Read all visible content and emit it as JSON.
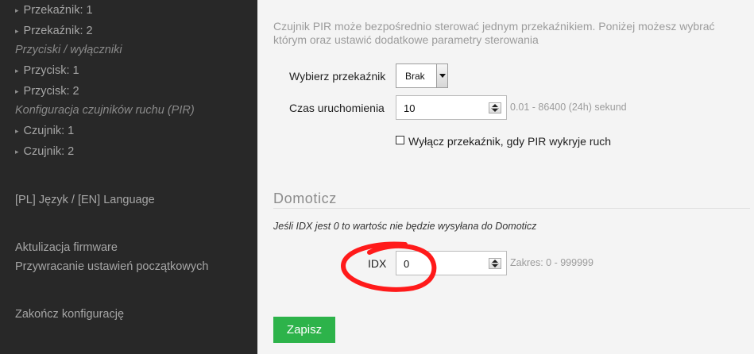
{
  "sidebar": {
    "items": [
      {
        "label": "Przekaźnik: 1",
        "arrow": true
      },
      {
        "label": "Przekaźnik: 2",
        "arrow": true
      },
      {
        "label": "Przyciski / wyłączniki",
        "heading": true
      },
      {
        "label": "Przycisk: 1",
        "arrow": true
      },
      {
        "label": "Przycisk: 2",
        "arrow": true
      },
      {
        "label": "Konfiguracja czujników ruchu (PIR)",
        "heading": true
      },
      {
        "label": "Czujnik: 1",
        "arrow": true
      },
      {
        "label": "Czujnik: 2",
        "arrow": true
      },
      {
        "label": "[PL] Język / [EN] Language"
      },
      {
        "label": "Aktulizacja firmware"
      },
      {
        "label": "Przywracanie ustawień początkowych"
      },
      {
        "label": "Zakończ konfigurację"
      }
    ],
    "arrow_glyph": "▸"
  },
  "main": {
    "intro": "Czujnik PIR może bezpośrednio sterować jednym przekaźnikiem. Poniżej możesz wybrać którym oraz ustawić dodatkowe parametry sterowania",
    "relay_label": "Wybierz przekaźnik",
    "relay_value": "Brak",
    "time_label": "Czas uruchomienia",
    "time_value": "10",
    "time_hint": "0.01 - 86400 (24h) sekund",
    "checkbox_label": "Wyłącz przekaźnik, gdy PIR wykryje ruch",
    "checkbox_checked": false,
    "section_title": "Domoticz",
    "idx_note": "Jeśli IDX jest 0 to wartośc nie będzie wysyłana do Domoticz",
    "idx_label": "IDX",
    "idx_value": "0",
    "idx_hint": "Zakres: 0 - 999999",
    "save_label": "Zapisz"
  },
  "colors": {
    "sidebar_bg": "#282828",
    "save_button": "#2db34a",
    "annotation_circle": "#ff1a1a"
  }
}
